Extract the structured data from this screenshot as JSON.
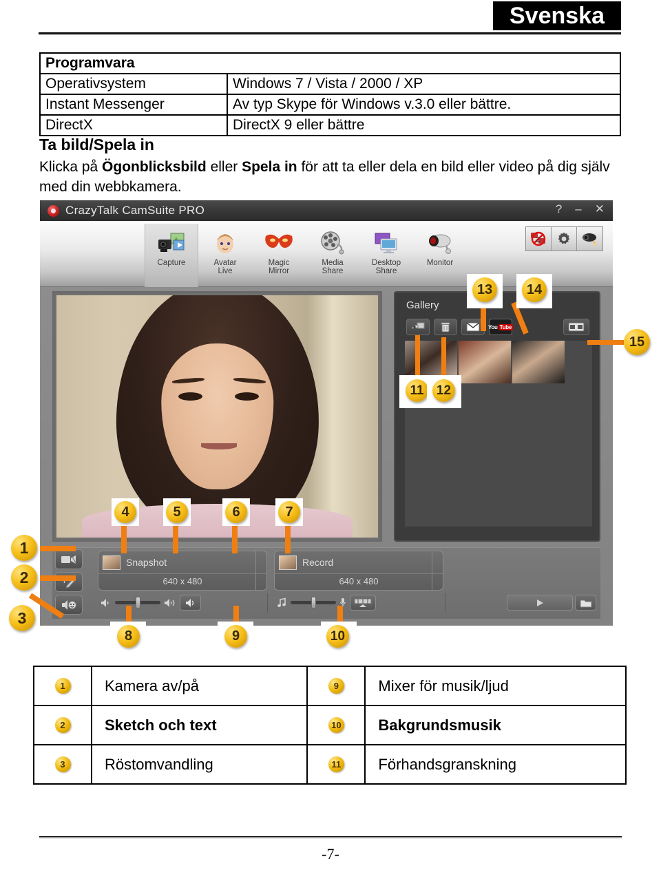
{
  "header": {
    "language_badge": "Svenska"
  },
  "spec_table": {
    "title": "Programvara",
    "rows": [
      {
        "label": "Operativsystem",
        "value": "Windows 7 / Vista / 2000 / XP"
      },
      {
        "label": "Instant Messenger",
        "value": "Av typ Skype för Windows v.3.0 eller bättre."
      },
      {
        "label": "DirectX",
        "value": "DirectX 9 eller bättre"
      }
    ]
  },
  "section": {
    "title": "Ta bild/Spela in",
    "body_part1": "Klicka på ",
    "body_bold1": "Ögonblicksbild",
    "body_part2": " eller ",
    "body_bold2": "Spela in",
    "body_part3": " för att ta eller dela en bild eller video på dig själv med din webbkamera."
  },
  "app": {
    "title": "CrazyTalk CamSuite PRO",
    "window_controls": {
      "help": "?",
      "minimize": "–",
      "close": "✕"
    },
    "ribbon": [
      {
        "label_line1": "Capture",
        "label_line2": "",
        "icon": "camera-photo-icon",
        "selected": true
      },
      {
        "label_line1": "Avatar",
        "label_line2": "Live",
        "icon": "baby-face-icon",
        "selected": false
      },
      {
        "label_line1": "Magic",
        "label_line2": "Mirror",
        "icon": "mask-icon",
        "selected": false
      },
      {
        "label_line1": "Media",
        "label_line2": "Share",
        "icon": "film-reel-icon",
        "selected": false
      },
      {
        "label_line1": "Desktop",
        "label_line2": "Share",
        "icon": "monitor-share-icon",
        "selected": false
      },
      {
        "label_line1": "Monitor",
        "label_line2": "",
        "icon": "webcam-icon",
        "selected": false
      }
    ],
    "ribbon_tools": [
      {
        "icon": "no-chat-icon"
      },
      {
        "icon": "gear-icon"
      },
      {
        "icon": "camera-settings-icon"
      }
    ],
    "gallery": {
      "title": "Gallery",
      "buttons": [
        {
          "icon": "export-icon"
        },
        {
          "icon": "trash-icon"
        },
        {
          "icon": "mail-icon"
        },
        {
          "icon": "youtube-icon",
          "label_you": "You",
          "label_tube": "Tube"
        }
      ],
      "view_button": {
        "icon": "filmstrip-view-icon"
      }
    },
    "controls": {
      "snapshot": {
        "label": "Snapshot",
        "resolution": "640 x 480"
      },
      "record": {
        "label": "Record",
        "resolution": "640 x 480"
      },
      "left_buttons": [
        {
          "icon": "camera-toggle-icon"
        },
        {
          "icon": "sketch-text-icon"
        },
        {
          "icon": "voice-change-icon"
        }
      ],
      "volume_slider": {
        "icon_low": "speaker-low-icon",
        "icon_high": "speaker-high-icon",
        "button_icon": "speaker-mute-icon"
      },
      "music_slider": {
        "icon_note": "music-note-icon",
        "icon_mic": "microphone-icon",
        "button_icon": "mixer-icon"
      },
      "playback": {
        "play_icon": "play-icon",
        "folder_icon": "folder-icon"
      }
    }
  },
  "callouts": [
    {
      "n": "1"
    },
    {
      "n": "2"
    },
    {
      "n": "3"
    },
    {
      "n": "4"
    },
    {
      "n": "5"
    },
    {
      "n": "6"
    },
    {
      "n": "7"
    },
    {
      "n": "8"
    },
    {
      "n": "9"
    },
    {
      "n": "10"
    },
    {
      "n": "11"
    },
    {
      "n": "12"
    },
    {
      "n": "13"
    },
    {
      "n": "14"
    },
    {
      "n": "15"
    }
  ],
  "legend": {
    "rows": [
      {
        "n1": "1",
        "t1": "Kamera av/på",
        "b1": false,
        "n2": "9",
        "t2": "Mixer för musik/ljud",
        "b2": false
      },
      {
        "n1": "2",
        "t1": "Sketch och text",
        "b1": true,
        "n2": "10",
        "t2": "Bakgrundsmusik",
        "b2": true
      },
      {
        "n1": "3",
        "t1": "Röstomvandling",
        "b1": false,
        "n2": "11",
        "t2": "Förhandsgranskning",
        "b2": false
      }
    ]
  },
  "footer": {
    "page_number": "-7-"
  }
}
